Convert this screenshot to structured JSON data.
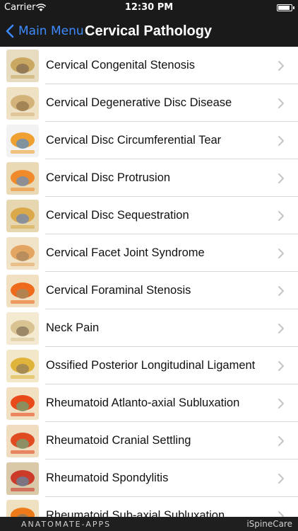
{
  "status_bar": {
    "carrier": "Carrier",
    "time": "12:30 PM"
  },
  "nav": {
    "back_label": "Main Menu",
    "title": "Cervical Pathology"
  },
  "items": [
    {
      "label": "Cervical Congenital Stenosis",
      "icon": "spine-axial-icon"
    },
    {
      "label": "Cervical Degenerative Disc Disease",
      "icon": "spine-lateral-icon"
    },
    {
      "label": "Cervical Disc Circumferential Tear",
      "icon": "disc-tear-icon"
    },
    {
      "label": "Cervical Disc Protrusion",
      "icon": "disc-protrusion-icon"
    },
    {
      "label": "Cervical Disc Sequestration",
      "icon": "disc-sequestration-icon"
    },
    {
      "label": "Cervical Facet Joint Syndrome",
      "icon": "facet-joint-icon"
    },
    {
      "label": "Cervical Foraminal Stenosis",
      "icon": "foraminal-stenosis-icon"
    },
    {
      "label": "Neck Pain",
      "icon": "neck-spine-icon"
    },
    {
      "label": "Ossified Posterior Longitudinal Ligament",
      "icon": "ligament-icon"
    },
    {
      "label": "Rheumatoid Atlanto-axial Subluxation",
      "icon": "rheumatoid-icon"
    },
    {
      "label": "Rheumatoid Cranial Settling",
      "icon": "cranial-settling-icon"
    },
    {
      "label": "Rheumatoid Spondylitis",
      "icon": "spondylitis-icon"
    },
    {
      "label": "Rheumatoid Sub-axial Subluxation",
      "icon": "subaxial-icon"
    }
  ],
  "footer": {
    "brand": "ANATOMATE-APPS",
    "app_name": "iSpineCare"
  },
  "colors": {
    "bar_bg": "#1a1a1a",
    "accent": "#3d8bff"
  }
}
